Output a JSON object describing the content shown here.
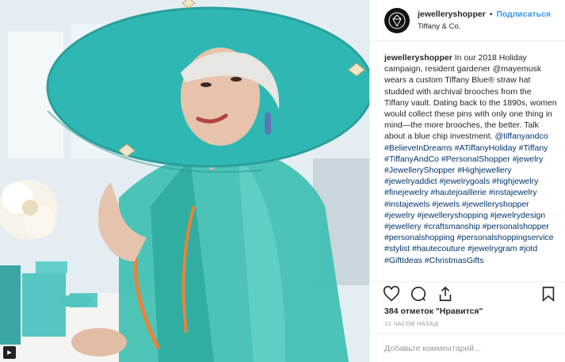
{
  "header": {
    "username": "jewelleryshopper",
    "separator": "•",
    "follow_label": "Подписаться",
    "location": "Tiffany & Co."
  },
  "caption": {
    "username": "jewelleryshopper",
    "text": "In our 2018 Holiday campaign, resident gardener @mayemusk wears a custom Tiffany Blue® straw hat studded with archival brooches from the Tiffany vault. Dating back to the 1890s, women would collect these pins with only one thing in mind—the more brooches, the better. Talk about a blue chip investment.",
    "hashtags": "@tiffanyandco #BelieveInDreams #ATiffanyHoliday #Tiffany #TiffanyAndCo #PersonalShopper #jewelry #JewelleryShopper #Highjewellery #jewelryaddict #jewelrygoals #highjewelry #finejewelry #hautejoaillerie #instajewelry #instajewels #jewels #jewelleryshopper #jewelry #jewelleryshopping #jewelrydesign #jewellery #craftsmanship #personalshopper #personalshopping #personalshoppingservice #stylist #hautecouture #jewelrygram #jotd #GiftIdeas #ChristmasGifts"
  },
  "actions": {
    "like_icon": "heart-icon",
    "comment_icon": "comment-icon",
    "share_icon": "share-icon",
    "save_icon": "bookmark-icon"
  },
  "likes": {
    "count": "384",
    "text": "отметок \"Нравится\""
  },
  "timestamp": "12 ЧАСОВ НАЗАД",
  "comment": {
    "placeholder": "Добавьте комментарий..."
  },
  "media": {
    "alt_badge": "▸",
    "colors": {
      "hat": "#2fb8b3",
      "raincoat": "#3fc1b4",
      "tiffany_box": "#52c7c2"
    }
  }
}
